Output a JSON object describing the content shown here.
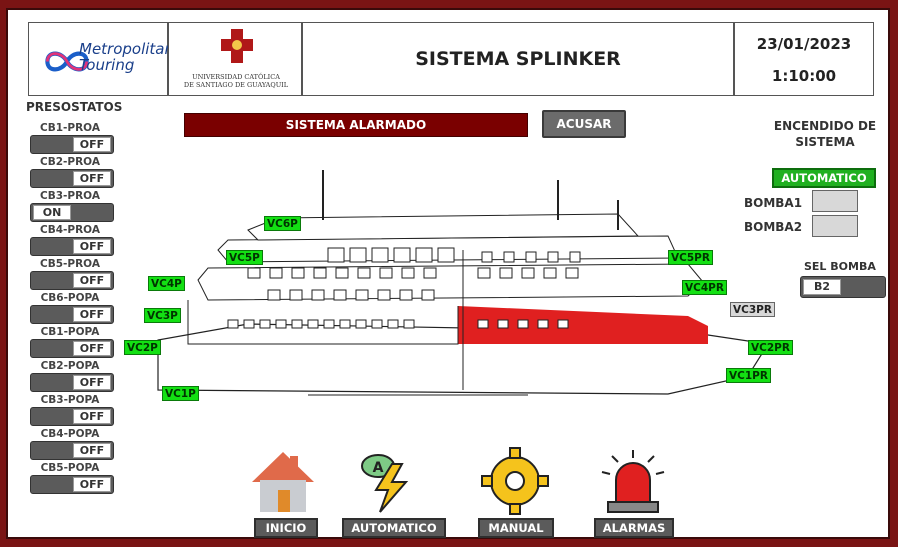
{
  "header": {
    "logo1_text": [
      "Metropolitan",
      "Touring"
    ],
    "logo2_text": [
      "UNIVERSIDAD CATÓLICA",
      "DE SANTIAGO DE GUAYAQUIL"
    ],
    "title": "SISTEMA SPLINKER",
    "date": "23/01/2023",
    "time": "1:10:00"
  },
  "presostatos": {
    "title": "PRESOSTATOS",
    "items": [
      {
        "label": "CB1-PROA",
        "state": "OFF"
      },
      {
        "label": "CB2-PROA",
        "state": "OFF"
      },
      {
        "label": "CB3-PROA",
        "state": "ON"
      },
      {
        "label": "CB4-PROA",
        "state": "OFF"
      },
      {
        "label": "CB5-PROA",
        "state": "OFF"
      },
      {
        "label": "CB6-POPA",
        "state": "OFF"
      },
      {
        "label": "CB1-POPA",
        "state": "OFF"
      },
      {
        "label": "CB2-POPA",
        "state": "OFF"
      },
      {
        "label": "CB3-POPA",
        "state": "OFF"
      },
      {
        "label": "CB4-POPA",
        "state": "OFF"
      },
      {
        "label": "CB5-POPA",
        "state": "OFF"
      }
    ]
  },
  "alarm": {
    "text": "SISTEMA ALARMADO",
    "acusar": "ACUSAR"
  },
  "right_panel": {
    "encendido_title": [
      "ENCENDIDO DE",
      "SISTEMA"
    ],
    "mode": "AUTOMATICO",
    "bomba1": "BOMBA1",
    "bomba2": "BOMBA2",
    "sel_bomba_title": "SEL BOMBA",
    "sel_bomba_value": "B2"
  },
  "valves": {
    "vc6p": "VC6P",
    "vc5p": "VC5P",
    "vc4p": "VC4P",
    "vc3p": "VC3P",
    "vc2p": "VC2P",
    "vc1p": "VC1P",
    "vc5pr": "VC5PR",
    "vc4pr": "VC4PR",
    "vc3pr": "VC3PR",
    "vc2pr": "VC2PR",
    "vc1pr": "VC1PR"
  },
  "nav": {
    "inicio": "INICIO",
    "automatico": "AUTOMATICO",
    "manual": "MANUAL",
    "alarmas": "ALARMAS"
  },
  "colors": {
    "frame": "#7a1414",
    "alarm": "#7a0000",
    "valve_on": "#13e013",
    "ship_alert": "#e02020"
  }
}
